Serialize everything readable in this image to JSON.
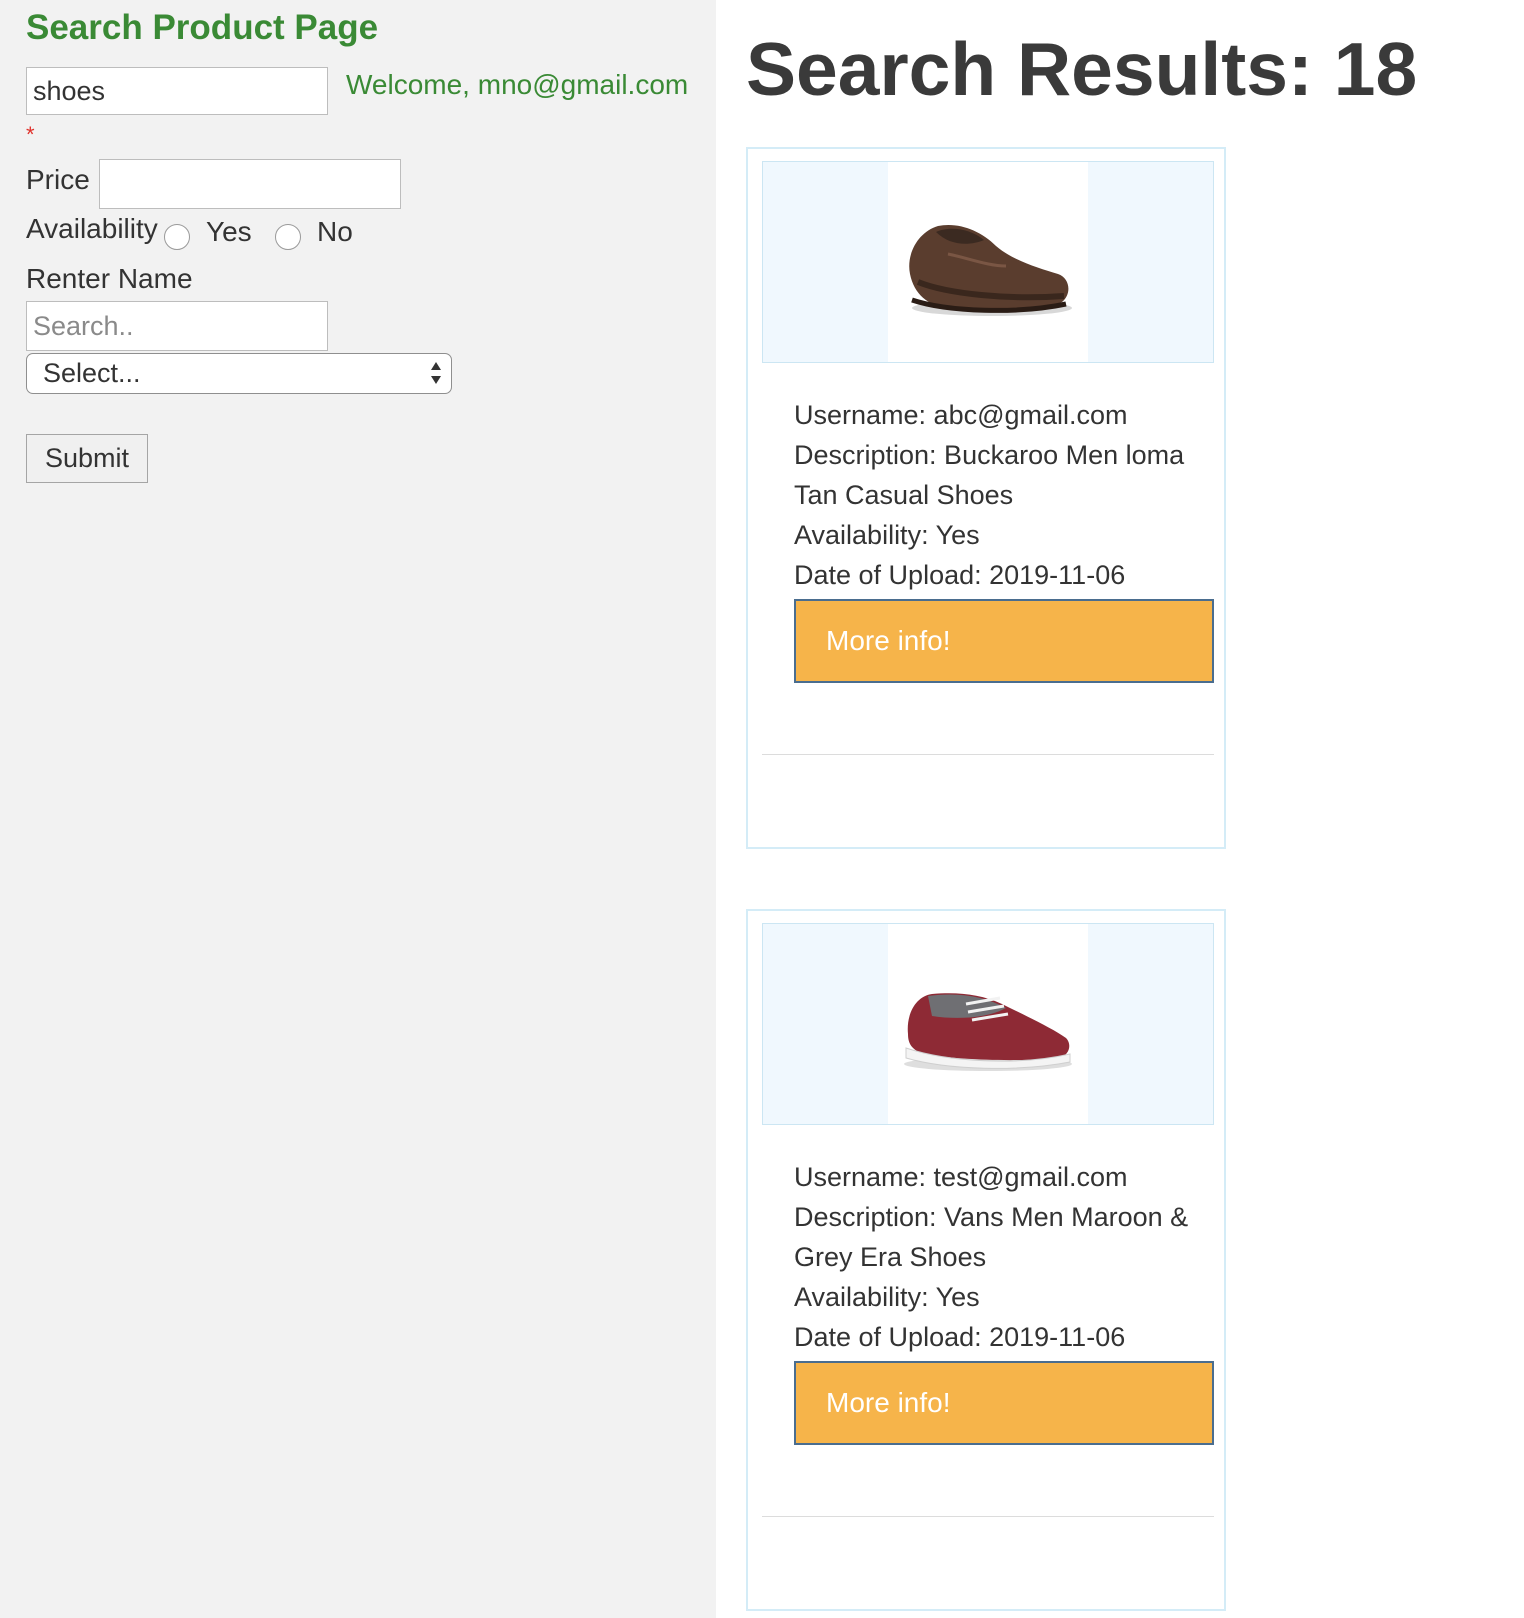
{
  "search_panel": {
    "title": "Search Product Page",
    "query_value": "shoes",
    "welcome_text": "Welcome, mno@gmail.com",
    "required_marker": "*",
    "price_label": "Price",
    "price_value": "",
    "availability_label": "Availability",
    "availability_options": [
      "Yes",
      "No"
    ],
    "renter_label": "Renter Name",
    "renter_placeholder": "Search..",
    "select_value": "Select...",
    "submit_label": "Submit"
  },
  "results": {
    "title": "Search Results: 18",
    "items": [
      {
        "image_icon": "brown-loafer-shoe-image",
        "username": "Username: abc@gmail.com",
        "description": "Description: Buckaroo Men loma Tan Casual Shoes",
        "availability": "Availability: Yes",
        "date": "Date of Upload: 2019-11-06",
        "button_label": "More info!"
      },
      {
        "image_icon": "maroon-grey-sneaker-image",
        "username": "Username: test@gmail.com",
        "description": "Description: Vans Men Maroon & Grey Era Shoes",
        "availability": "Availability: Yes",
        "date": "Date of Upload: 2019-11-06",
        "button_label": "More info!"
      }
    ]
  },
  "colors": {
    "title_green": "#3a8a35",
    "button_orange": "#f6b44a",
    "card_border": "#d4ecf7",
    "panel_bg": "#f2f2f2"
  }
}
